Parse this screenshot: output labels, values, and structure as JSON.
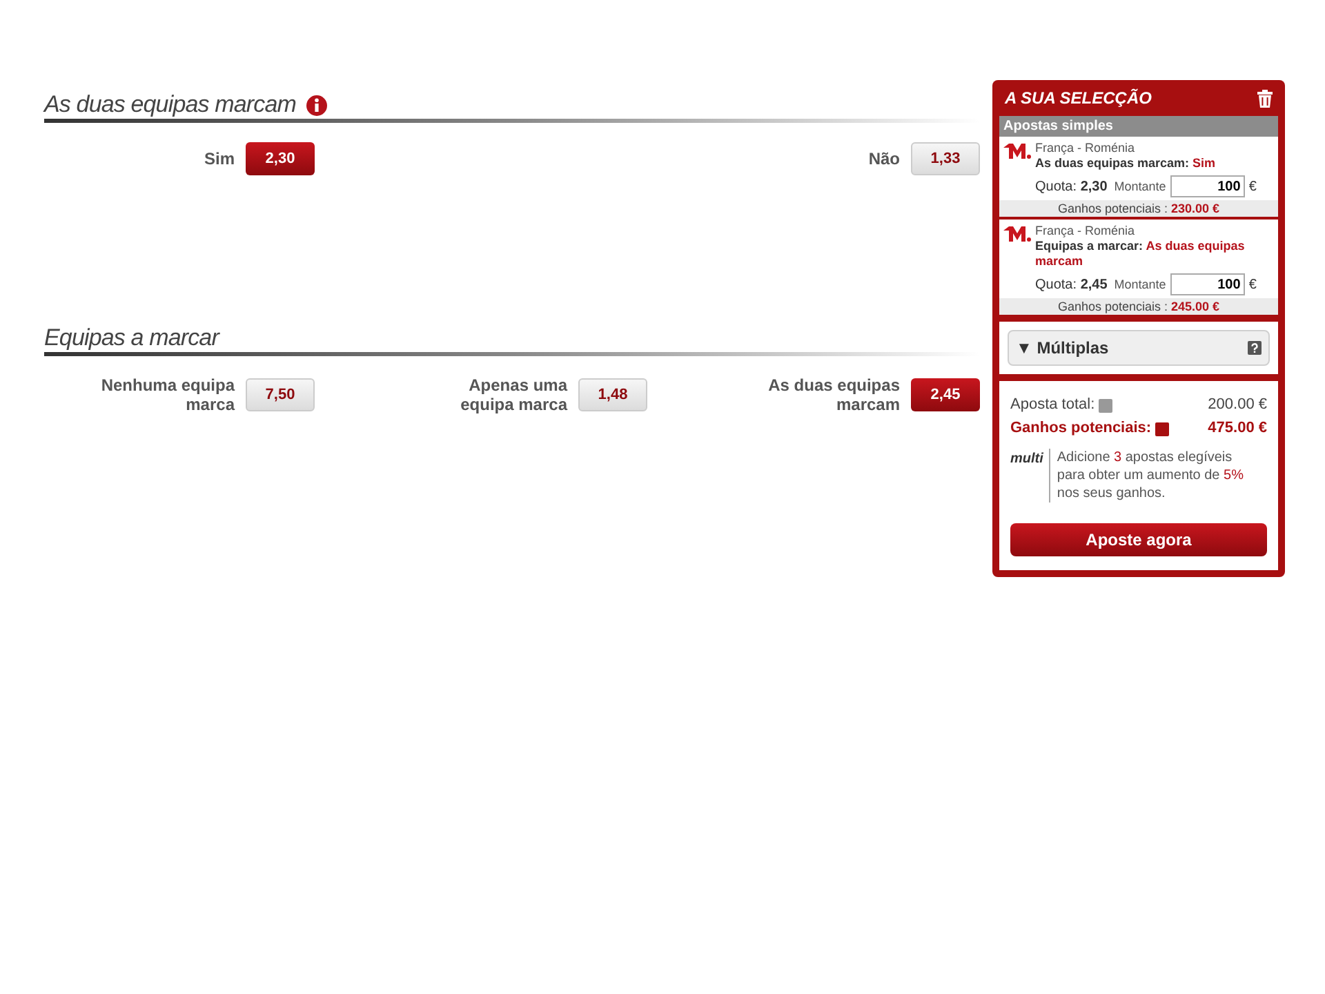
{
  "markets": [
    {
      "title": "As duas equipas marcam",
      "info": true,
      "outcomes": [
        {
          "label": "Sim",
          "odds": "2,30",
          "selected": true
        },
        {
          "label": "Não",
          "odds": "1,33",
          "selected": false
        }
      ]
    },
    {
      "title": "Equipas a marcar",
      "info": false,
      "outcomes": [
        {
          "label": "Nenhuma equipa marca",
          "odds": "7,50",
          "selected": false
        },
        {
          "label": "Apenas uma equipa marca",
          "odds": "1,48",
          "selected": false
        },
        {
          "label": "As duas equipas marcam",
          "odds": "2,45",
          "selected": true
        }
      ]
    }
  ],
  "betslip": {
    "title": "A SUA SELECÇÃO",
    "section": "Apostas simples",
    "bets": [
      {
        "match": "França - Roménia",
        "market": "As duas equipas marcam:",
        "pick": "Sim",
        "odds_label": "Quota:",
        "odds": "2,30",
        "stake_label": "Montante",
        "stake": "100",
        "currency": "€",
        "winnings_label": "Ganhos potenciais :",
        "winnings": "230.00 €"
      },
      {
        "match": "França - Roménia",
        "market": "Equipas a marcar:",
        "pick": "As duas equipas marcam",
        "odds_label": "Quota:",
        "odds": "2,45",
        "stake_label": "Montante",
        "stake": "100",
        "currency": "€",
        "winnings_label": "Ganhos potenciais :",
        "winnings": "245.00 €"
      }
    ],
    "multiples": {
      "label": "Múltiplas",
      "arrow": "▼"
    },
    "total_label": "Aposta total:",
    "total": "200.00 €",
    "potential_label": "Ganhos potenciais:",
    "potential": "475.00 €",
    "promo_logo": "multi",
    "promo": "Adicione **3** apostas elegíveis para obter um aumento de **5%** nos seus ganhos.",
    "button": "Aposte agora"
  }
}
